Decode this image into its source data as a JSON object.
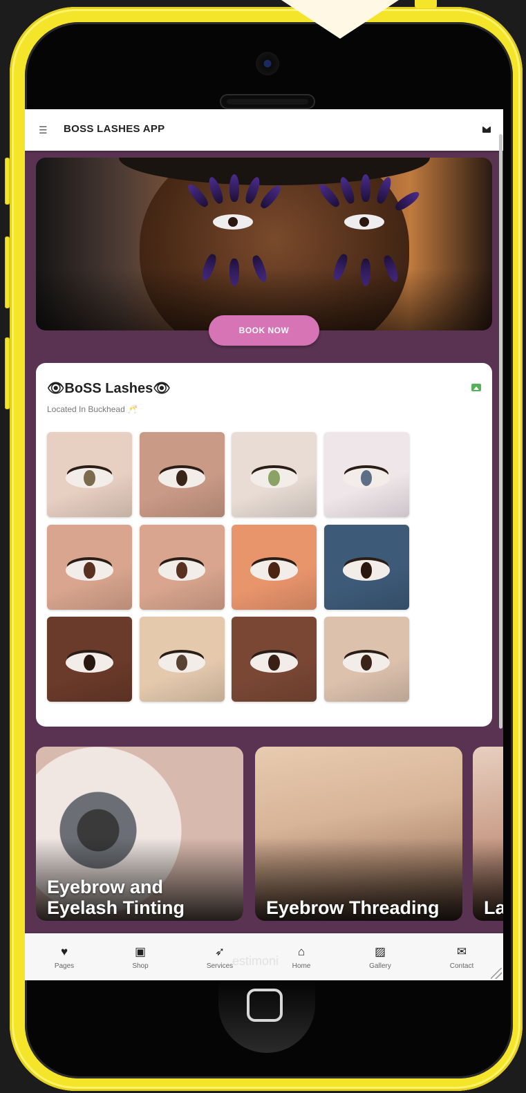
{
  "app": {
    "title": "BOSS LASHES APP",
    "accent": "#d774b6",
    "background": "#5a3352"
  },
  "header": {
    "menu_icon": "hamburger-icon",
    "mail_icon": "envelope-icon"
  },
  "hero": {
    "book_label": "BOOK NOW"
  },
  "gallery": {
    "title": "👁BoSS Lashes👁",
    "subtitle": "Located In Buckhead 🥂",
    "icon": "image-icon",
    "thumbs": [
      {
        "bg": "#e7cfc1",
        "iris": "#7b6a4c"
      },
      {
        "bg": "#c99a86",
        "iris": "#3a2418"
      },
      {
        "bg": "#e8dcd4",
        "iris": "#8aa264"
      },
      {
        "bg": "#efe6ea",
        "iris": "#5c6f86"
      },
      {
        "bg": "#d9a58e",
        "iris": "#5a3020"
      },
      {
        "bg": "#d9a58e",
        "iris": "#5a3020"
      },
      {
        "bg": "#e9956c",
        "iris": "#4b2412"
      },
      {
        "bg": "#3d5a78",
        "iris": "#2a1810"
      },
      {
        "bg": "#6a3a2a",
        "iris": "#2a1810"
      },
      {
        "bg": "#e4c9ad",
        "iris": "#5a4232"
      },
      {
        "bg": "#7a4734",
        "iris": "#3a2014"
      },
      {
        "bg": "#dcc1ad",
        "iris": "#3a2418"
      }
    ]
  },
  "services": [
    {
      "label": "Eyebrow and Eyelash Tinting"
    },
    {
      "label": "Eyebrow Threading"
    },
    {
      "label": "La"
    }
  ],
  "tabbar": {
    "ghost_text": "estimoni",
    "tabs": [
      {
        "label": "Pages",
        "icon": "heart-icon"
      },
      {
        "label": "Shop",
        "icon": "shopping-bag-icon"
      },
      {
        "label": "Services",
        "icon": "rocket-icon"
      },
      {
        "label": "Home",
        "icon": "home-icon"
      },
      {
        "label": "Gallery",
        "icon": "image-icon"
      },
      {
        "label": "Contact",
        "icon": "envelope-icon"
      }
    ]
  }
}
